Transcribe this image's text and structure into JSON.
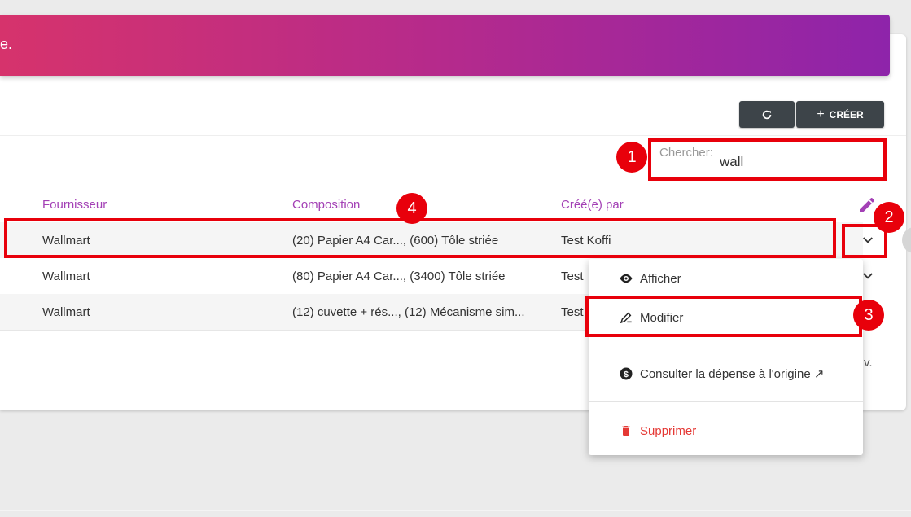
{
  "banner": {
    "text": "e."
  },
  "toolbar": {
    "create_label": "CRÉER",
    "create_plus": "+"
  },
  "search": {
    "label": "Chercher:",
    "value": "wall"
  },
  "table": {
    "headers": [
      "Fournisseur",
      "Composition",
      "Créé(e) par"
    ],
    "rows": [
      {
        "fournisseur": "Wallmart",
        "composition": "(20) Papier A4 Car..., (600) Tôle striée",
        "created_by": "Test Koffi"
      },
      {
        "fournisseur": "Wallmart",
        "composition": "(80) Papier A4 Car..., (3400) Tôle striée",
        "created_by": "Test"
      },
      {
        "fournisseur": "Wallmart",
        "composition": "(12) cuvette + rés..., (12) Mécanisme sim...",
        "created_by": "Test"
      }
    ],
    "pager_tail": "v."
  },
  "menu": {
    "items": [
      {
        "label": "Afficher",
        "icon": "eye-icon"
      },
      {
        "label": "Modifier",
        "icon": "pencil-icon"
      },
      {
        "label": "Consulter la dépense à l'origine ↗",
        "icon": "dollar-circle-icon"
      },
      {
        "label": "Supprimer",
        "icon": "trash-icon"
      }
    ]
  },
  "annotations": {
    "badges": [
      "1",
      "2",
      "3",
      "4"
    ]
  },
  "colors": {
    "banner_start": "#d6336c",
    "banner_end": "#8e24aa",
    "header_text": "#a340b5",
    "button_bg": "#3d4449",
    "annotation_red": "#e8000b",
    "delete_red": "#e53935"
  }
}
